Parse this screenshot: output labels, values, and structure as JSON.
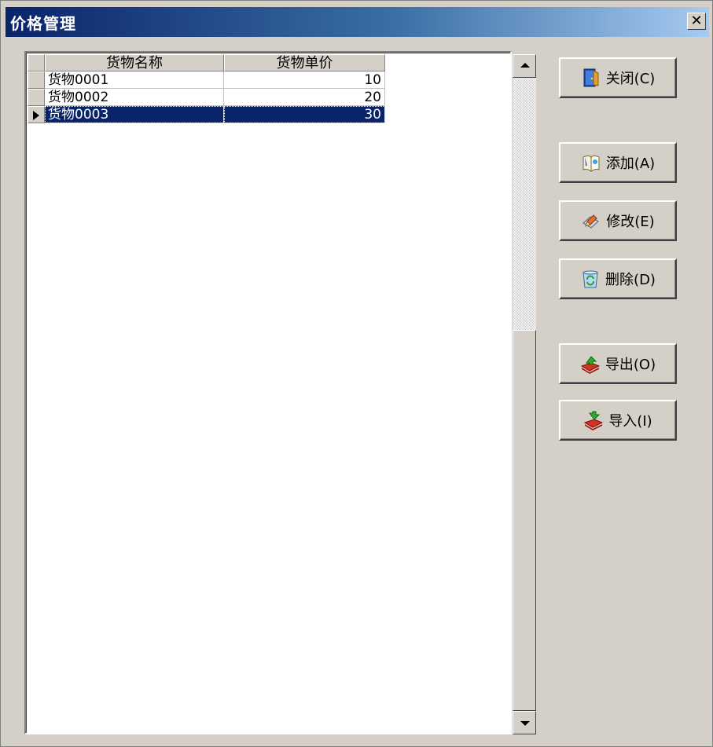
{
  "window": {
    "title": "价格管理",
    "close_glyph": "✕"
  },
  "grid": {
    "columns": [
      "货物名称",
      "货物单价"
    ],
    "rows": [
      {
        "name": "货物0001",
        "price": "10"
      },
      {
        "name": "货物0002",
        "price": "20"
      },
      {
        "name": "货物0003",
        "price": "30"
      }
    ],
    "selected_row": 2
  },
  "buttons": {
    "close": {
      "label": "关闭(C)",
      "icon": "door-icon"
    },
    "add": {
      "label": "添加(A)",
      "icon": "add-book-icon"
    },
    "edit": {
      "label": "修改(E)",
      "icon": "edit-pencil-icon"
    },
    "delete": {
      "label": "删除(D)",
      "icon": "recycle-bin-icon"
    },
    "export": {
      "label": "导出(O)",
      "icon": "export-books-icon"
    },
    "import": {
      "label": "导入(I)",
      "icon": "import-books-icon"
    }
  },
  "colors": {
    "title_start": "#0a246a",
    "title_end": "#a6caf0",
    "selection": "#0a246a",
    "face": "#d4d0c8"
  }
}
